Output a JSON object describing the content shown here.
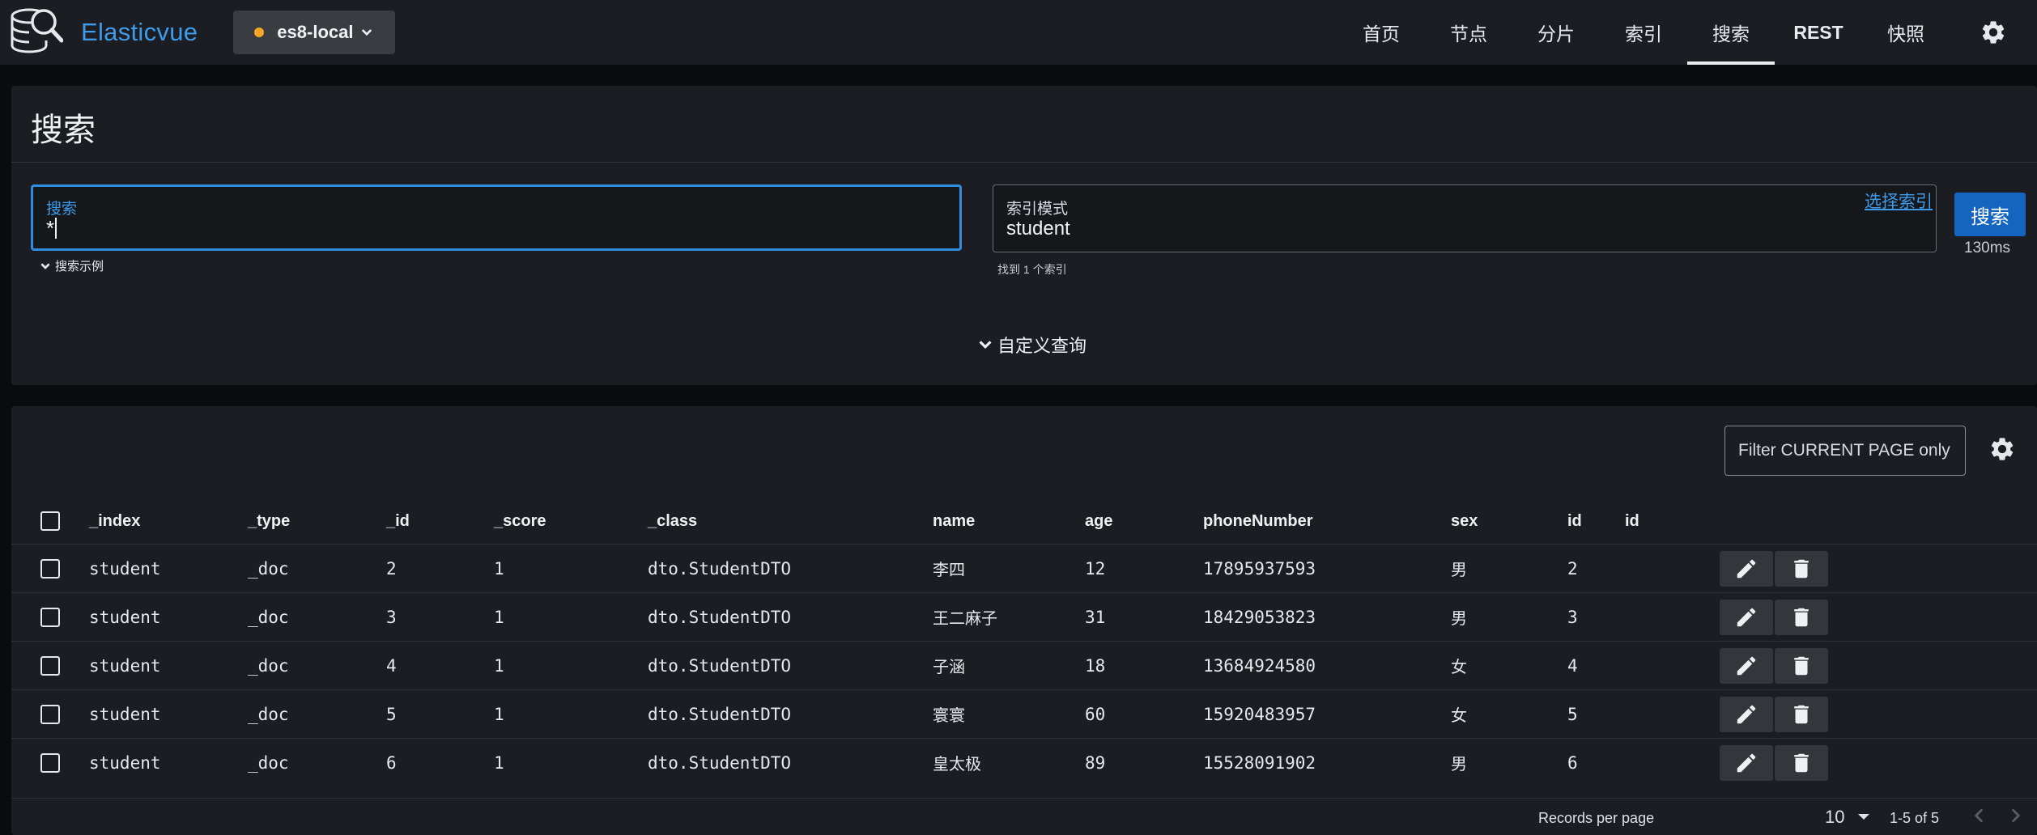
{
  "app": {
    "name": "Elasticvue"
  },
  "cluster": {
    "name": "es8-local",
    "status_color": "#f5a623"
  },
  "nav": {
    "items": [
      {
        "label": "首页",
        "active": false
      },
      {
        "label": "节点",
        "active": false
      },
      {
        "label": "分片",
        "active": false
      },
      {
        "label": "索引",
        "active": false
      },
      {
        "label": "搜索",
        "active": true
      },
      {
        "label": "REST",
        "active": false
      },
      {
        "label": "快照",
        "active": false
      }
    ],
    "settings_icon": "gear-icon"
  },
  "search": {
    "page_title": "搜索",
    "query_label": "搜索",
    "query_value": "*",
    "examples_label": "搜索示例",
    "index_label": "索引模式",
    "index_value": "student",
    "choose_index_label": "选择索引",
    "found_hint": "找到 1 个索引",
    "button_label": "搜索",
    "took": "130ms",
    "custom_query_label": "自定义查询"
  },
  "results": {
    "filter_placeholder": "Filter CURRENT PAGE only",
    "columns": [
      "_index",
      "_type",
      "_id",
      "_score",
      "_class",
      "name",
      "age",
      "phoneNumber",
      "sex",
      "id",
      "id"
    ],
    "rows": [
      [
        "student",
        "_doc",
        "2",
        "1",
        "dto.StudentDTO",
        "李四",
        "12",
        "17895937593",
        "男",
        "2"
      ],
      [
        "student",
        "_doc",
        "3",
        "1",
        "dto.StudentDTO",
        "王二麻子",
        "31",
        "18429053823",
        "男",
        "3"
      ],
      [
        "student",
        "_doc",
        "4",
        "1",
        "dto.StudentDTO",
        "子涵",
        "18",
        "13684924580",
        "女",
        "4"
      ],
      [
        "student",
        "_doc",
        "5",
        "1",
        "dto.StudentDTO",
        "寰寰",
        "60",
        "15920483957",
        "女",
        "5"
      ],
      [
        "student",
        "_doc",
        "6",
        "1",
        "dto.StudentDTO",
        "皇太极",
        "89",
        "15528091902",
        "男",
        "6"
      ]
    ],
    "footer": {
      "rows_per_page_label": "Records per page",
      "rows_per_page_value": "10",
      "range": "1-5 of 5"
    }
  }
}
